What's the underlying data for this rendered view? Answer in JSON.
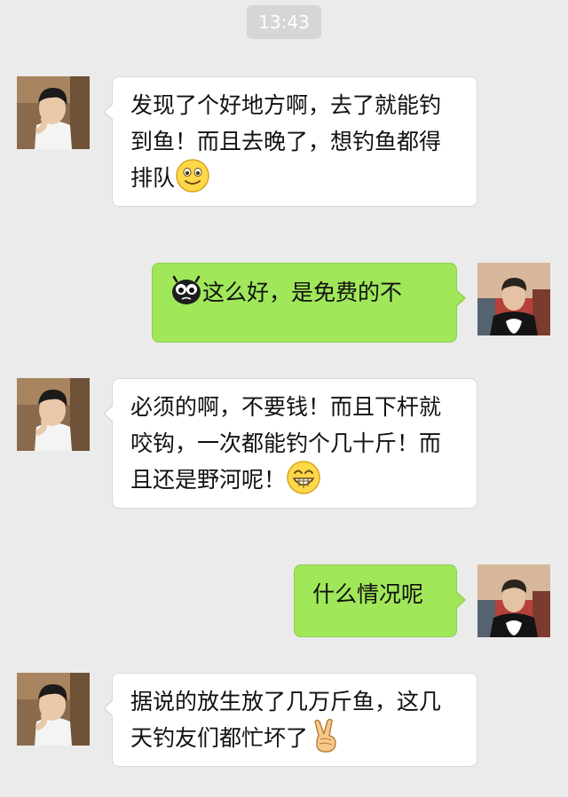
{
  "chat": {
    "timestamp": "13:43",
    "messages": [
      {
        "side": "left",
        "text": "发现了个好地方啊，去了就能钓到鱼！而且去晚了，想钓鱼都得排队",
        "emoji": "smile-emoji"
      },
      {
        "side": "right",
        "text": "这么好，是免费的不",
        "emoji": "bug-eyed-emoji"
      },
      {
        "side": "left",
        "text": "必须的啊，不要钱！而且下杆就咬钩，一次都能钓个几十斤！而且还是野河呢！",
        "emoji": "grin-emoji"
      },
      {
        "side": "right",
        "text": "什么情况呢",
        "emoji": ""
      },
      {
        "side": "left",
        "text": "据说的放生放了几万斤鱼，这几天钓友们都忙坏了",
        "emoji": "victory-hand-emoji"
      }
    ]
  },
  "colors": {
    "background": "#ebebeb",
    "incoming_bubble": "#ffffff",
    "outgoing_bubble": "#a0e75a",
    "timestamp_bg": "#d6d6d6"
  }
}
